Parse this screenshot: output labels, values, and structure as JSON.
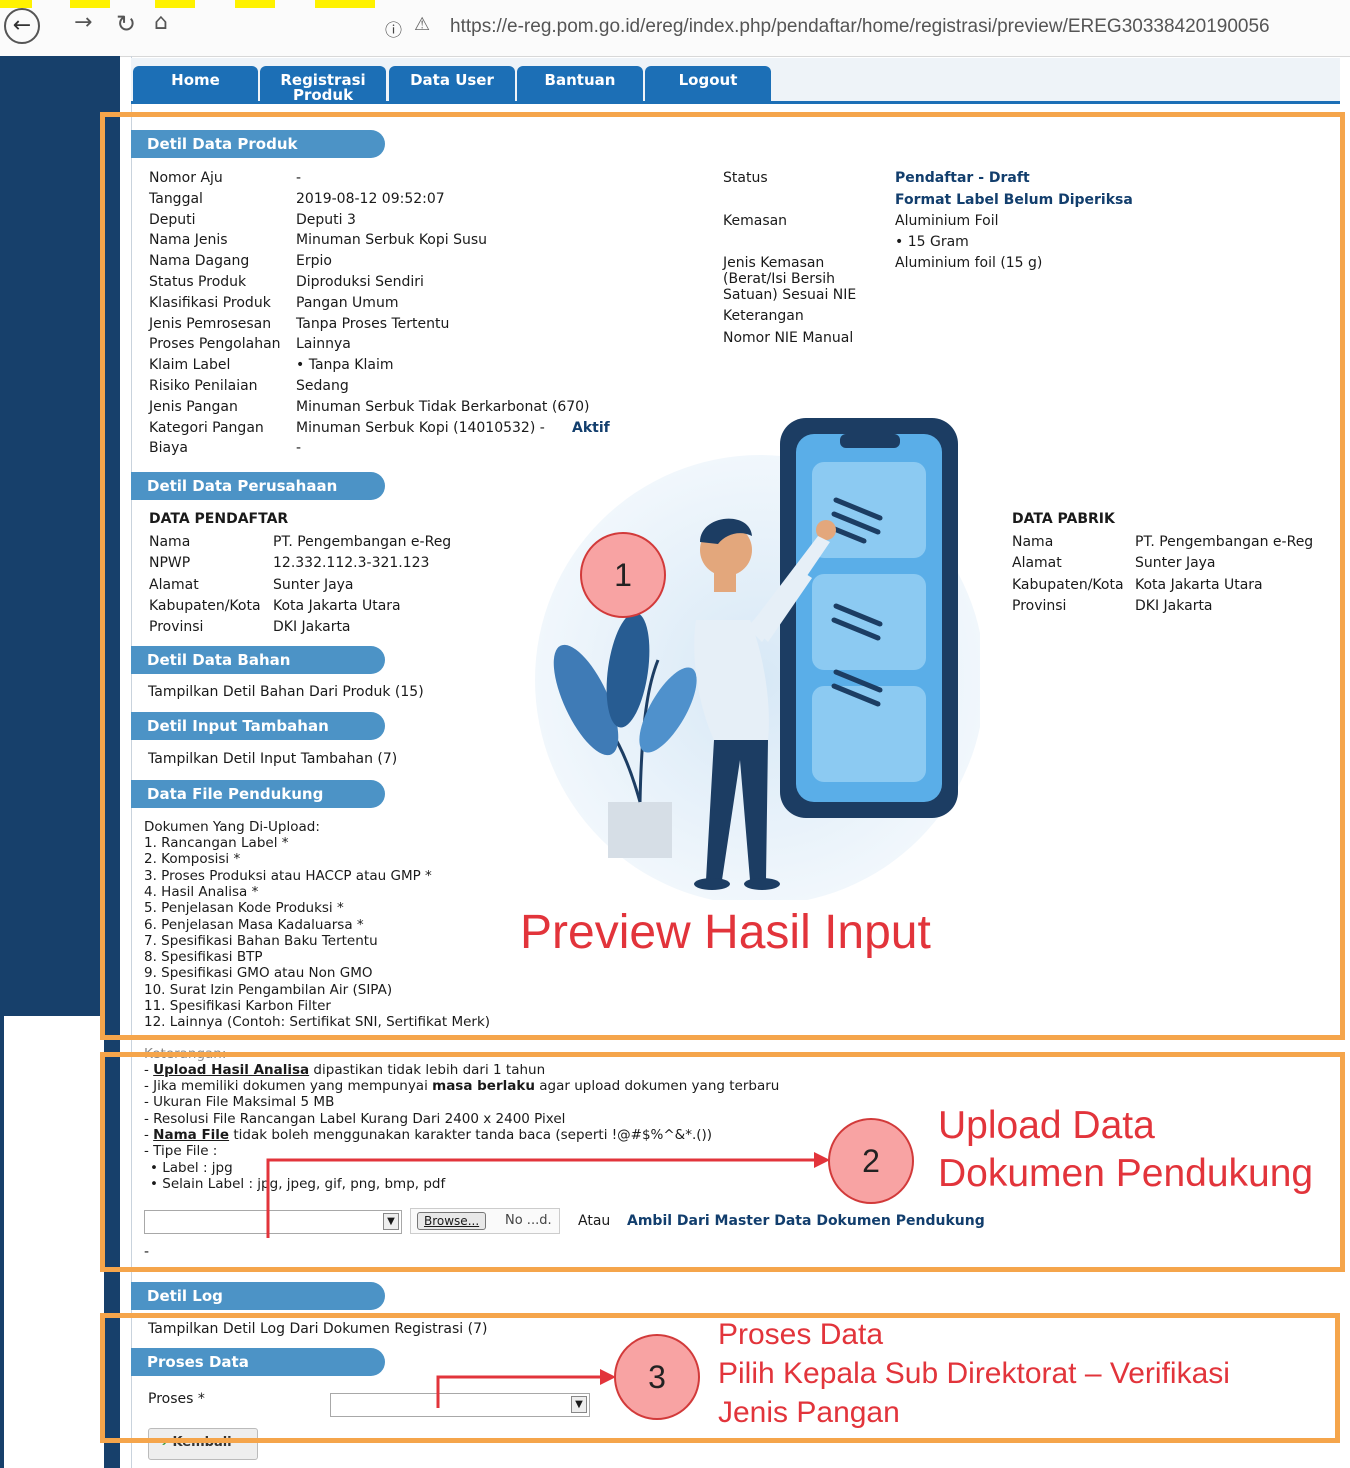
{
  "browser": {
    "url": "https://e-reg.pom.go.id/ereg/index.php/pendaftar/home/registrasi/preview/EREG30338420190056",
    "back_icon": "back-arrow-icon",
    "forward_icon": "forward-arrow-icon",
    "reload_icon": "reload-icon",
    "home_icon": "home-icon"
  },
  "nav": {
    "tabs": [
      "Home",
      "Registrasi Produk",
      "Data User",
      "Bantuan",
      "Logout"
    ]
  },
  "produk": {
    "header": "Detil Data Produk",
    "rows": [
      {
        "label": "Nomor Aju",
        "value": "-"
      },
      {
        "label": "Tanggal",
        "value": "2019-08-12 09:52:07"
      },
      {
        "label": "Deputi",
        "value": "Deputi 3"
      },
      {
        "label": "Nama Jenis",
        "value": "Minuman Serbuk Kopi Susu"
      },
      {
        "label": "Nama Dagang",
        "value": "Erpio"
      },
      {
        "label": "Status Produk",
        "value": "Diproduksi Sendiri"
      },
      {
        "label": "Klasifikasi Produk",
        "value": "Pangan Umum"
      },
      {
        "label": "Jenis Pemrosesan",
        "value": "Tanpa Proses Tertentu"
      },
      {
        "label": "Proses Pengolahan",
        "value": "Lainnya"
      },
      {
        "label": "Klaim Label",
        "value": "• Tanpa Klaim"
      },
      {
        "label": "Risiko Penilaian",
        "value": "Sedang"
      },
      {
        "label": "Jenis Pangan",
        "value": "Minuman Serbuk Tidak Berkarbonat (670)"
      },
      {
        "label": "Kategori Pangan",
        "value": "Minuman Serbuk Kopi (14010532) - "
      },
      {
        "label": "Biaya",
        "value": "-"
      }
    ],
    "kategori_status": "Aktif",
    "right": {
      "status_label": "Status",
      "status_value": "Pendaftar - Draft",
      "format_label_status": "Format Label Belum Diperiksa",
      "kemasan_label": "Kemasan",
      "kemasan_value": "Aluminium Foil",
      "kemasan_sub": "• 15 Gram",
      "jenis_kemasan_label_1": "Jenis Kemasan",
      "jenis_kemasan_label_2": "(Berat/Isi Bersih",
      "jenis_kemasan_label_3": "Satuan) Sesuai NIE",
      "jenis_kemasan_value": "Aluminium foil (15 g)",
      "keterangan_label": "Keterangan",
      "nie_label": "Nomor NIE Manual"
    }
  },
  "perusahaan": {
    "header": "Detil Data Perusahaan",
    "pendaftar_title": "DATA PENDAFTAR",
    "pendaftar": [
      {
        "label": "Nama",
        "value": "PT. Pengembangan e-Reg"
      },
      {
        "label": "NPWP",
        "value": "12.332.112.3-321.123"
      },
      {
        "label": "Alamat",
        "value": "Sunter Jaya"
      },
      {
        "label": "Kabupaten/Kota",
        "value": "Kota Jakarta Utara"
      },
      {
        "label": "Provinsi",
        "value": "DKI Jakarta"
      }
    ],
    "pabrik_title": "DATA PABRIK",
    "pabrik": [
      {
        "label": "Nama",
        "value": "PT. Pengembangan e-Reg"
      },
      {
        "label": "Alamat",
        "value": "Sunter Jaya"
      },
      {
        "label": "Kabupaten/Kota",
        "value": "Kota Jakarta Utara"
      },
      {
        "label": "Provinsi",
        "value": "DKI Jakarta"
      }
    ]
  },
  "bahan": {
    "header": "Detil Data Bahan",
    "link": "Tampilkan Detil Bahan Dari Produk (15)"
  },
  "tambahan": {
    "header": "Detil Input Tambahan",
    "link": "Tampilkan Detil Input Tambahan (7)"
  },
  "file": {
    "header": "Data File Pendukung",
    "intro": "Dokumen Yang Di-Upload:",
    "docs": [
      "1. Rancangan Label *",
      "2. Komposisi *",
      "3. Proses Produksi atau HACCP atau GMP *",
      "4. Hasil Analisa *",
      "5. Penjelasan Kode Produksi *",
      "6. Penjelasan Masa Kadaluarsa *",
      "7. Spesifikasi Bahan Baku Tertentu",
      "8. Spesifikasi BTP",
      "9. Spesifikasi GMO atau Non GMO",
      "10. Surat Izin Pengambilan Air (SIPA)",
      "11. Spesifikasi Karbon Filter",
      "12. Lainnya (Contoh: Sertifikat SNI, Sertifikat Merk)"
    ]
  },
  "keterangan": {
    "title": "Keterangan:",
    "line1_bold": "Upload Hasil Analisa",
    "line1_rest": " dipastikan tidak lebih dari 1 tahun",
    "line2_a": "- Jika memiliki dokumen yang mempunyai ",
    "line2_bold": "masa berlaku",
    "line2_b": " agar upload dokumen yang terbaru",
    "line3": "- Ukuran File Maksimal 5 MB",
    "line4": "- Resolusi File Rancangan Label Kurang Dari 2400 x 2400 Pixel",
    "line5_bold": "Nama File",
    "line5_rest": " tidak boleh menggunakan karakter tanda baca (seperti !@#$%^&*.())",
    "line6": "- Tipe File :",
    "line7": "• Label : jpg",
    "line8": "• Selain Label : jpg, jpeg, gif, png, bmp, pdf",
    "browse_label": "Browse...",
    "file_status": "No ...d.",
    "atau": "Atau",
    "master_link": "Ambil Dari Master Data Dokumen Pendukung",
    "dash": "-"
  },
  "log": {
    "header": "Detil Log",
    "link": "Tampilkan Detil Log Dari Dokumen Registrasi (7)"
  },
  "proses": {
    "header": "Proses Data",
    "label": "Proses *",
    "kembali": "Kembali"
  },
  "annotations": {
    "num1": "1",
    "num2": "2",
    "num3": "3",
    "preview": "Preview Hasil Input",
    "upload_1": "Upload Data",
    "upload_2": "Dokumen Pendukung",
    "proses_1": "Proses Data",
    "proses_2": "Pilih  Kepala Sub Direktorat – Verifikasi",
    "proses_3": "Jenis Pangan"
  },
  "colors": {
    "accent": "#1c6fb6",
    "section_header": "#4c93c6",
    "sidebar": "#17406b",
    "annotation_box": "#f5a54b",
    "annotation_text": "#e2343b"
  }
}
